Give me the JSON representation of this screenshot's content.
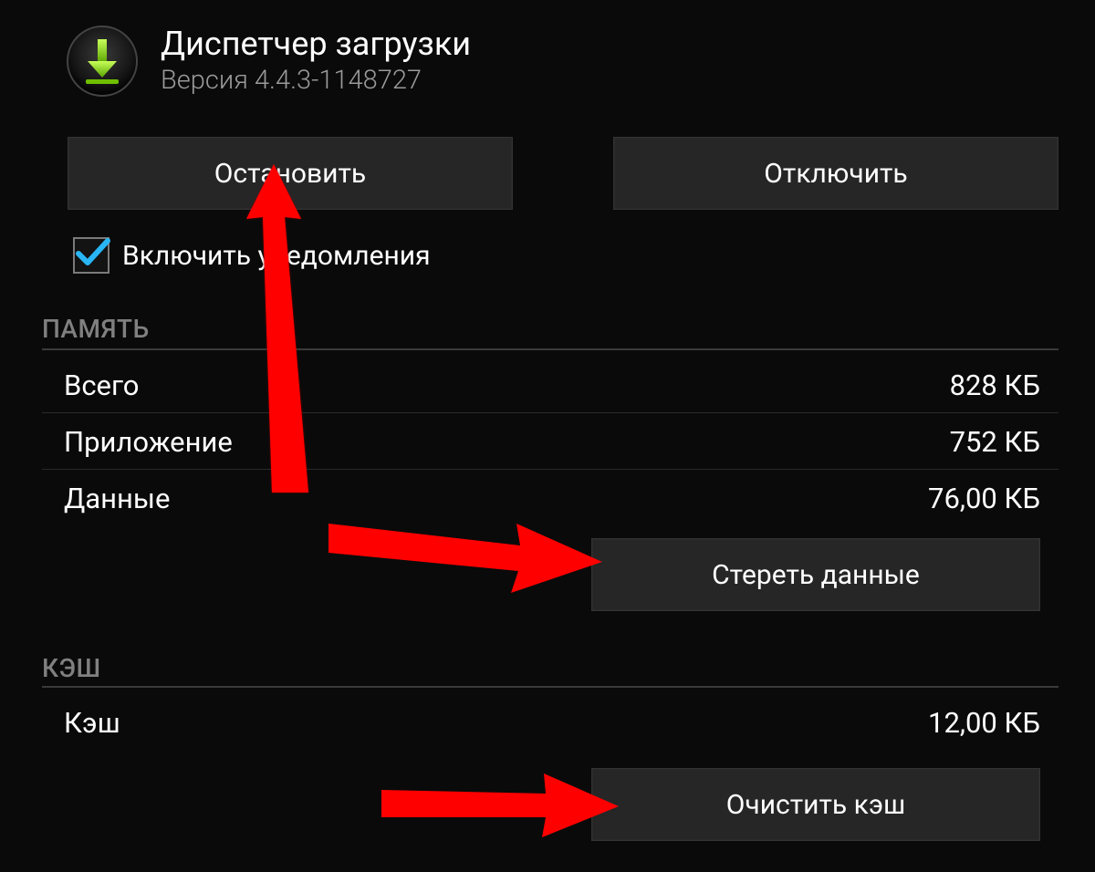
{
  "header": {
    "app_name": "Диспетчер загрузки",
    "version_label": "Версия 4.4.3-1148727",
    "icon_name": "download-icon"
  },
  "actions": {
    "stop_label": "Остановить",
    "disable_label": "Отключить"
  },
  "notifications": {
    "checked": true,
    "label": "Включить уведомления"
  },
  "memory": {
    "section_title": "ПАМЯТЬ",
    "rows": {
      "total": {
        "label": "Всего",
        "value": "828 КБ"
      },
      "app": {
        "label": "Приложение",
        "value": "752 КБ"
      },
      "data": {
        "label": "Данные",
        "value": "76,00 КБ"
      }
    },
    "clear_data_label": "Стереть данные"
  },
  "cache": {
    "section_title": "КЭШ",
    "rows": {
      "cache": {
        "label": "Кэш",
        "value": "12,00 КБ"
      }
    },
    "clear_cache_label": "Очистить кэш"
  },
  "colors": {
    "background": "#0a0a0a",
    "button_bg": "#262626",
    "divider": "#3a3a3a",
    "annotation_arrow": "#ff0000",
    "icon_accent": "#7ac100"
  }
}
